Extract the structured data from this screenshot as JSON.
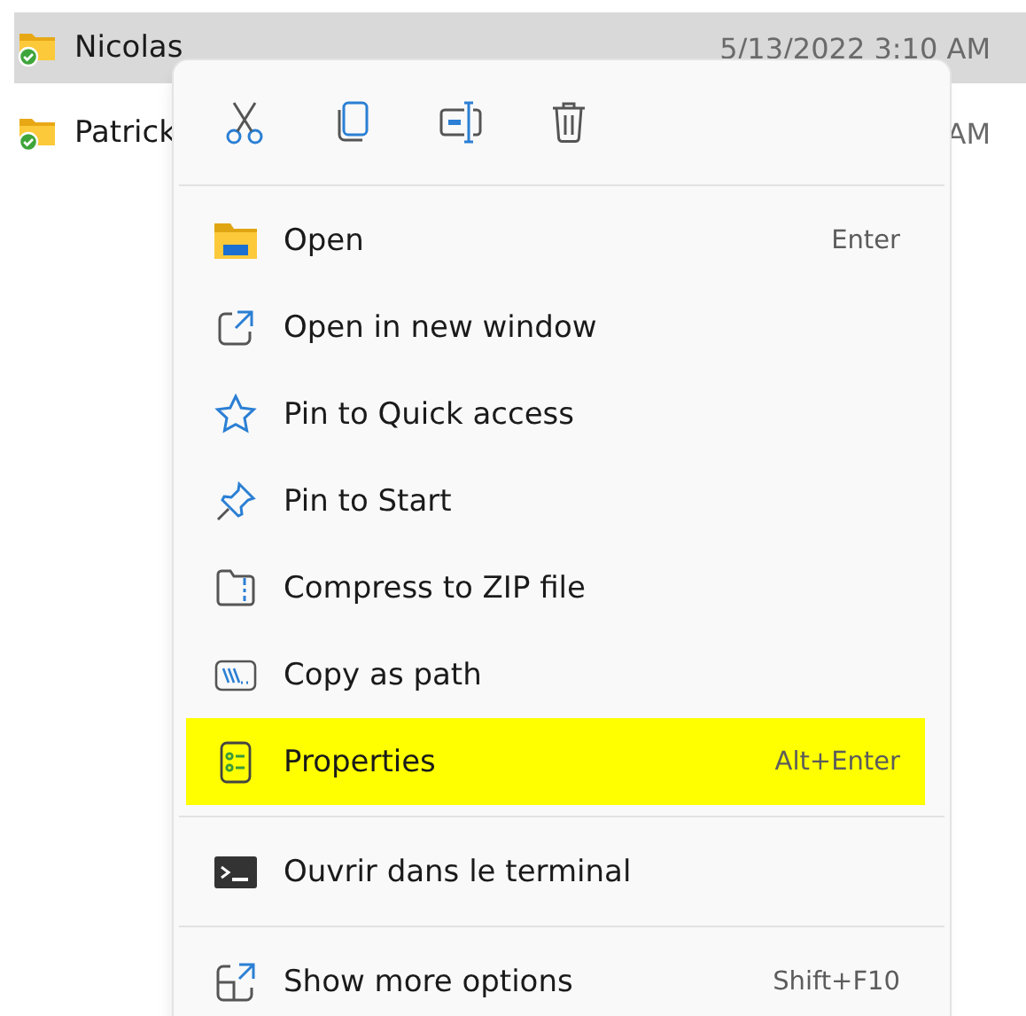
{
  "files": [
    {
      "name": "Nicolas",
      "date": "5/13/2022 3:10 AM",
      "selected": true
    },
    {
      "name": "Patrick",
      "date": "AM",
      "selected": false
    }
  ],
  "context_menu": {
    "sections": [
      [
        {
          "label": "Open",
          "shortcut": "Enter",
          "highlighted": false
        },
        {
          "label": "Open in new window",
          "highlighted": false
        },
        {
          "label": "Pin to Quick access",
          "highlighted": false
        },
        {
          "label": "Pin to Start",
          "highlighted": false
        },
        {
          "label": "Compress to ZIP file",
          "highlighted": false
        },
        {
          "label": "Copy as path",
          "highlighted": false
        },
        {
          "label": "Properties",
          "shortcut": "Alt+Enter",
          "highlighted": true
        }
      ],
      [
        {
          "label": "Ouvrir dans le terminal",
          "highlighted": false
        }
      ],
      [
        {
          "label": "Show more options",
          "shortcut": "Shift+F10",
          "highlighted": false
        }
      ]
    ]
  }
}
